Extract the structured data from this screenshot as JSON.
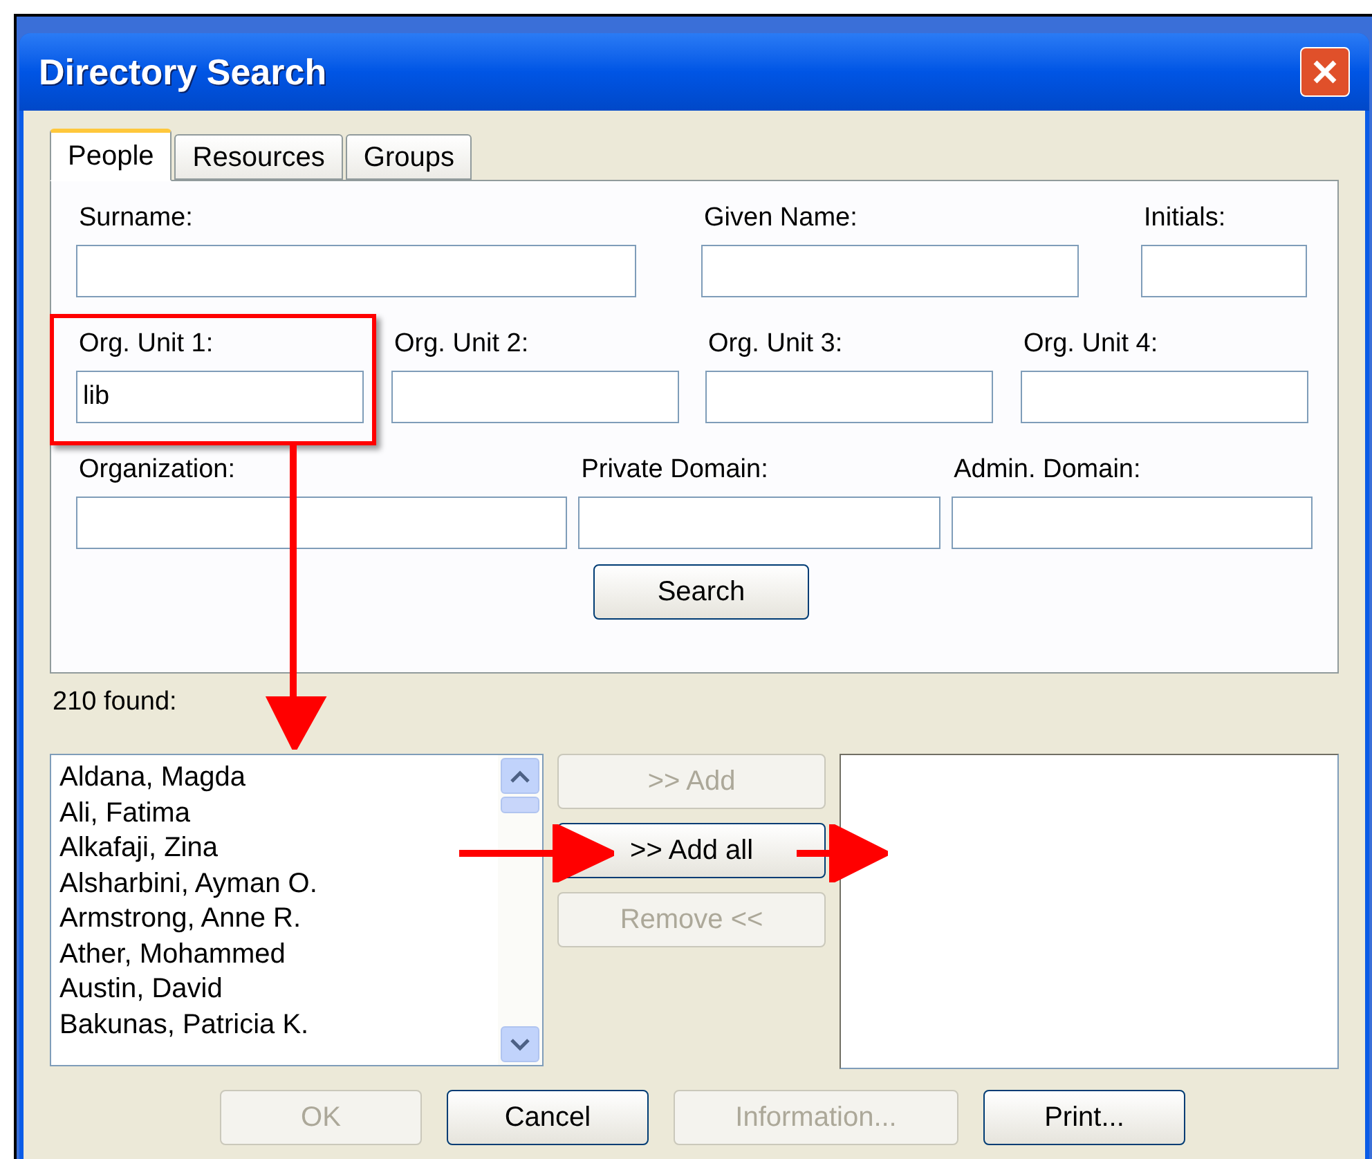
{
  "window": {
    "title": "Directory Search"
  },
  "tabs": [
    {
      "label": "People",
      "selected": true
    },
    {
      "label": "Resources",
      "selected": false
    },
    {
      "label": "Groups",
      "selected": false
    }
  ],
  "field_rows": [
    [
      {
        "label": "Surname:"
      },
      {
        "label": "Given Name:"
      },
      {
        "label": "Initials:"
      }
    ],
    [
      {
        "label": "Org. Unit 1:",
        "value": "lib"
      },
      {
        "label": "Org. Unit 2:"
      },
      {
        "label": "Org. Unit 3:"
      },
      {
        "label": "Org. Unit 4:"
      }
    ],
    [
      {
        "label": "Organization:"
      },
      {
        "label": "Private Domain:"
      },
      {
        "label": "Admin. Domain:"
      }
    ]
  ],
  "search_button": "Search",
  "results_count": "210 found:",
  "results": [
    "Aldana, Magda",
    "Ali, Fatima",
    "Alkafaji, Zina",
    "Alsharbini, Ayman O.",
    "Armstrong, Anne R.",
    "Ather, Mohammed",
    "Austin, David",
    "Bakunas, Patricia K."
  ],
  "transfer_buttons": [
    {
      "label": ">> Add",
      "disabled": true
    },
    {
      "label": ">> Add all",
      "disabled": false
    },
    {
      "label": "Remove <<",
      "disabled": true
    }
  ],
  "dialog_buttons": [
    {
      "label": "OK",
      "disabled": true
    },
    {
      "label": "Cancel",
      "disabled": false
    },
    {
      "label": "Information...",
      "disabled": true
    },
    {
      "label": "Print...",
      "disabled": false
    }
  ]
}
